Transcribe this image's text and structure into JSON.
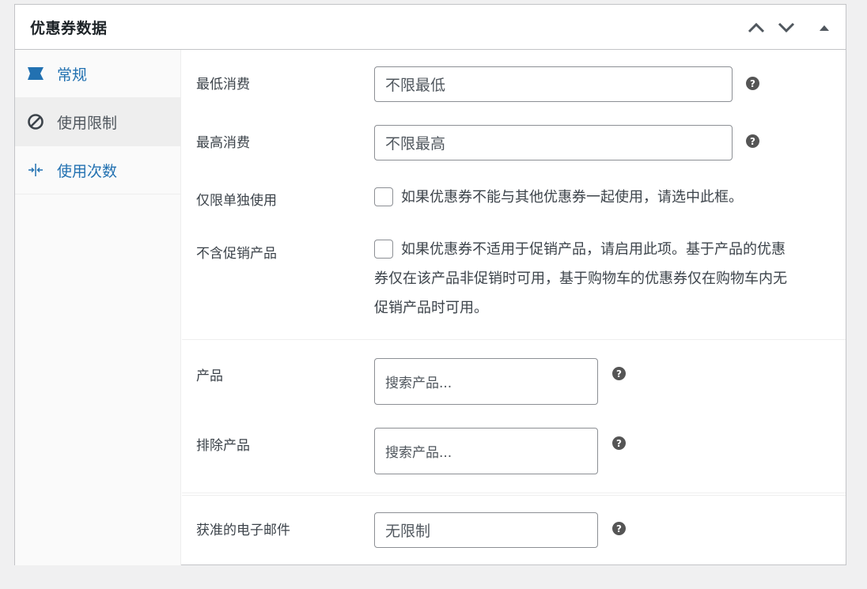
{
  "panel": {
    "title": "优惠券数据",
    "buttons": {
      "move_up": "move-up",
      "move_down": "move-down",
      "toggle": "toggle"
    }
  },
  "tabs": [
    {
      "label": "常规",
      "icon": "ticket-icon",
      "active": false
    },
    {
      "label": "使用限制",
      "icon": "prohibited-icon",
      "active": true
    },
    {
      "label": "使用次数",
      "icon": "arrows-in-icon",
      "active": false
    }
  ],
  "fields": {
    "min_spend": {
      "label": "最低消费",
      "placeholder": "不限最低"
    },
    "max_spend": {
      "label": "最高消费",
      "placeholder": "不限最高"
    },
    "individual_use": {
      "label": "仅限单独使用",
      "description": "如果优惠券不能与其他优惠券一起使用，请选中此框。"
    },
    "exclude_sale": {
      "label": "不含促销产品",
      "description_lines": [
        "如果优惠券不适用于促销产品，请启用此项。基于产品的优惠",
        "券仅在该产品非促销时可用，基于购物车的优惠券仅在购物车内无",
        "促销产品时可用。"
      ]
    },
    "products": {
      "label": "产品",
      "placeholder": "搜索产品..."
    },
    "exclude_products": {
      "label": "排除产品",
      "placeholder": "搜索产品..."
    },
    "allowed_emails": {
      "label": "获准的电子邮件",
      "placeholder": "无限制"
    }
  },
  "help_glyph": "?",
  "colors": {
    "link": "#2271b1",
    "border": "#c3c4c7",
    "help_icon": "#555555"
  }
}
